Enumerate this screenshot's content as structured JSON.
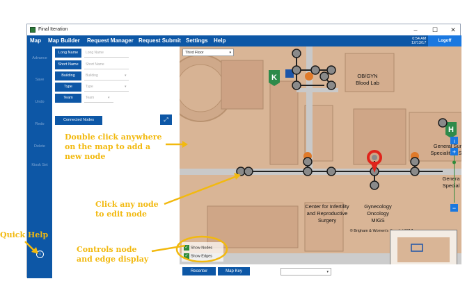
{
  "window": {
    "title": "Final Iteration",
    "controls": {
      "minimize": "–",
      "maximize": "☐",
      "close": "✕"
    }
  },
  "menubar": {
    "items": [
      "Map",
      "Map Builder",
      "Request Manager",
      "Request Submit",
      "Settings",
      "Help"
    ],
    "time": "0:54 AM",
    "date": "12/13/17",
    "logoff": "Logoff"
  },
  "sidebar": {
    "items": [
      "Advance",
      "Save",
      "Undo",
      "Redo",
      "Delete",
      "Kiosk Set"
    ],
    "info_icon": "i"
  },
  "form": {
    "long_name": {
      "label": "Long Name",
      "placeholder": "Long Name"
    },
    "short_name": {
      "label": "Short Name",
      "placeholder": "Short Name"
    },
    "building": {
      "label": "Building",
      "placeholder": "Building"
    },
    "type": {
      "label": "Type",
      "placeholder": "Type"
    },
    "team": {
      "label": "Team",
      "placeholder": "Team"
    },
    "connected_nodes": "Connected Nodes",
    "expand_icon": "⤢"
  },
  "map": {
    "floor_select": "Third Floor",
    "labels": {
      "obgyn": [
        "OB/GYN",
        "Blood Lab"
      ],
      "fertility": [
        "Center for Infertility",
        "and Reproductive",
        "Surgery"
      ],
      "gyn_onc": [
        "Gynecology",
        "Oncology",
        "MIGS"
      ],
      "general_top": [
        "General Sur",
        "Specialities Se"
      ],
      "general_right": [
        "Genera",
        "Special"
      ],
      "copyright": "© Brigham & Women's Hospital 2017"
    },
    "toggles": {
      "show_nodes": "Show Nodes",
      "show_edges": "Show Edges"
    },
    "recenter": "Recenter",
    "map_key": "Map Key",
    "zoom": {
      "info": "i",
      "plus": "+",
      "minus": "−"
    },
    "badges": {
      "k": "K",
      "h": "H"
    }
  },
  "annotations": {
    "double_click": [
      "Double click anywhere",
      "on the map to add a",
      "new node"
    ],
    "click_node": [
      "Click any node",
      "to edit node"
    ],
    "controls": [
      "Controls node",
      "and edge display"
    ],
    "quick_help": "Quick Help"
  },
  "colors": {
    "app_blue": "#0d57a6",
    "logoff_blue": "#1a78e0",
    "annotation_yellow": "#f2b90f",
    "node_gray": "#8a8a8a",
    "selected_red": "#e0241b",
    "map_tan": "#d9b596",
    "corridor_gray": "#c9c9c9"
  }
}
